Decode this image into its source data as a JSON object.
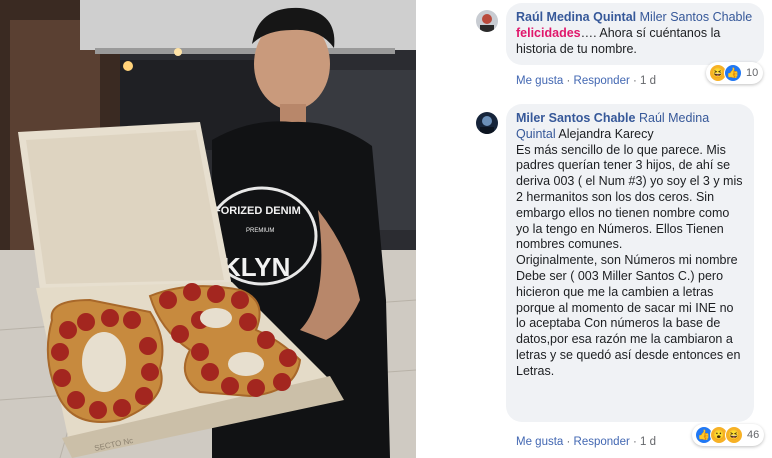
{
  "photo": {
    "caption": "Man holding an open pizza box with pepperoni pizza shaped as 003",
    "shirt_text_top": "FORIZED DENIM",
    "shirt_text_mid": "PREMIUM",
    "shirt_text_bottom": "KLYN",
    "box_text": "SECTO Nc"
  },
  "comments": [
    {
      "author": "Raúl Medina Quintal",
      "mention": "Miler Santos Chable",
      "highlight": "felicidades",
      "text_rest": "…. Ahora sí cuéntanos la historia de tu nombre.",
      "like_label": "Me gusta",
      "reply_label": "Responder",
      "time": "1 d",
      "reaction_count": "10",
      "reactions": [
        "haha-icon",
        "like-icon"
      ]
    },
    {
      "author": "Miler Santos Chable",
      "mention": "Raúl Medina Quintal",
      "mention2": "Alejandra Karecy",
      "paragraph1": "Es más sencillo de lo que parece. Mis padres querían tener 3 hijos, de ahí se deriva 003 ( el Num #3) yo soy el 3 y mis 2 hermanitos son los dos ceros. Sin embargo ellos no tienen nombre como yo la tengo en Números. Ellos Tienen nombres comunes.",
      "paragraph2": "Originalmente, son Números mi nombre Debe ser ( 003 Miller Santos C.) pero hicieron que me la cambien a letras porque al momento de sacar mi INE no lo aceptaba Con números la base de datos,por esa razón me la cambiaron a letras y se quedó así desde entonces en Letras.",
      "like_label": "Me gusta",
      "reply_label": "Responder",
      "time": "1 d",
      "reaction_count": "46",
      "reactions": [
        "like-icon",
        "wow-icon",
        "haha-icon"
      ]
    }
  ],
  "colors": {
    "author": "#365899",
    "highlight": "#e0176b",
    "bubble": "#f0f2f5",
    "like": "#2078f4"
  }
}
